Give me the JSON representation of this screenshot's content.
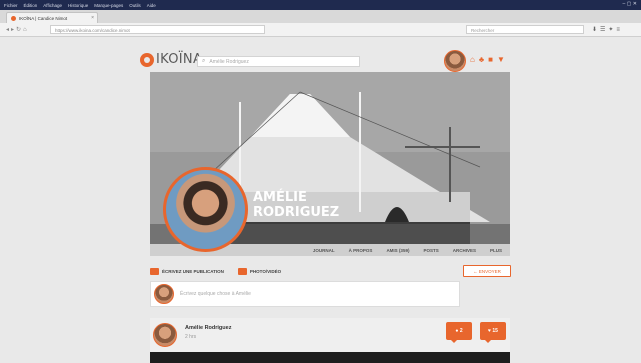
{
  "os_menu": [
    "Fichier",
    "Édition",
    "Affichage",
    "Historique",
    "Marque-pages",
    "Outils",
    "Aide"
  ],
  "window_controls": "– ▢ ✕",
  "browser": {
    "tab_title": "IKOÏNA | Candice Nimot",
    "url": "https://www.ikoina.com/candice.nimot",
    "search_placeholder": "Rechercher"
  },
  "site": {
    "logo": "IKOÏNA",
    "search_placeholder": "Amélie Rodriguez",
    "accent": "#e8662d"
  },
  "profile": {
    "name_line1": "AMÉLIE",
    "name_line2": "RODRIGUEZ",
    "nav": [
      "JOURNAL",
      "À PROPOS",
      "AMIS (359)",
      "POSTS",
      "ARCHIVES",
      "PLUS"
    ]
  },
  "composer": {
    "tab_publication": "ÉCRIVEZ UNE PUBLICATION",
    "tab_photo": "PHOTO/VIDÉO",
    "send": "← ENVOYER",
    "placeholder": "Écrivez quelque chose à Amélie"
  },
  "post": {
    "author": "Amélie Rodriguez",
    "time": "2 hrs",
    "comments": "2",
    "likes": "15"
  }
}
